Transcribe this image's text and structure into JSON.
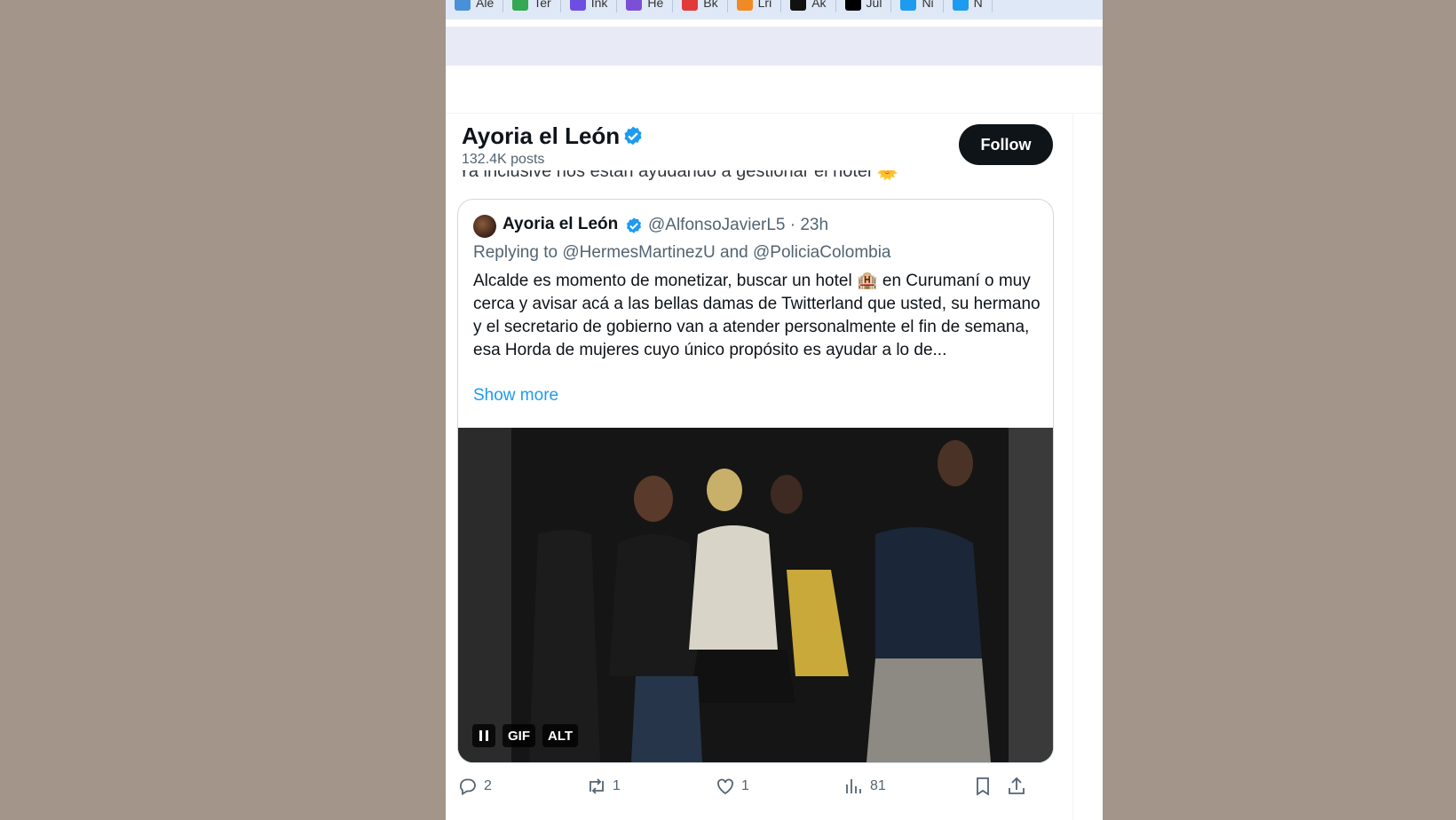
{
  "bookmarks": [
    {
      "label": "Ale",
      "color": "#4a90d9"
    },
    {
      "label": "Ter",
      "color": "#34a853"
    },
    {
      "label": "Ink",
      "color": "#6c4ee0"
    },
    {
      "label": "He",
      "color": "#7b4fd6"
    },
    {
      "label": "Bk",
      "color": "#e03a3a"
    },
    {
      "label": "Lri",
      "color": "#f08a24"
    },
    {
      "label": "Ak",
      "color": "#111111"
    },
    {
      "label": "Jul",
      "color": "#000000"
    },
    {
      "label": "Ni",
      "color": "#1d9bf0"
    },
    {
      "label": "N",
      "color": "#1d9bf0"
    }
  ],
  "header": {
    "name": "Ayoria el León",
    "posts": "132.4K posts",
    "follow_label": "Follow"
  },
  "cutoff_text": "Ya inclusive nos están ayudando a gestionar el hotel 🌞",
  "quote": {
    "name": "Ayoria el León",
    "handle_time": "@AlfonsoJavierL5 · 23h",
    "replying_prefix": "Replying to ",
    "reply_user1": "@HermesMartinezU",
    "reply_and": " and ",
    "reply_user2": "@PoliciaColombia",
    "text": "Alcalde es momento de monetizar, buscar un hotel 🏨 en Curumaní o muy cerca y avisar acá a las bellas damas de Twitterland que usted, su hermano y el secretario de gobierno van a atender personalmente el fin de semana, esa Horda de mujeres cuyo único propósito es ayudar a lo de...",
    "show_more": "Show more",
    "gif_label": "GIF",
    "alt_label": "ALT",
    "pause_icon": "pause-icon"
  },
  "actions": {
    "replies": "2",
    "reposts": "1",
    "likes": "1",
    "views": "81"
  },
  "colors": {
    "accent": "#1d9bf0",
    "text": "#0f1419",
    "secondary": "#536471",
    "page_bg": "#a39589"
  }
}
